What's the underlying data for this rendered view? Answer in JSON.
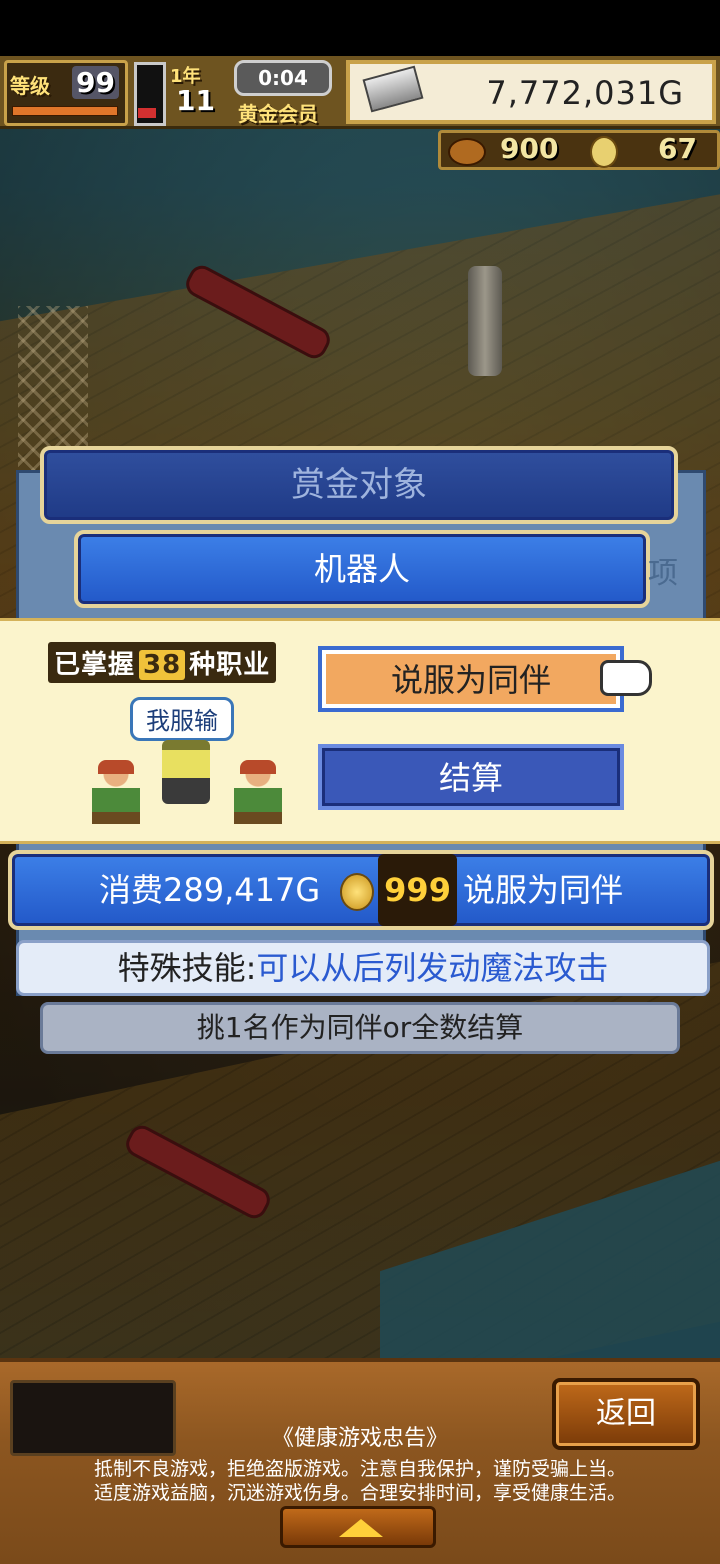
{
  "hud": {
    "level_label": "等级",
    "level": "99",
    "year_label": "1年",
    "year": "11",
    "clock": "0:04",
    "member": "黄金会员",
    "gold": "7,772,031G",
    "food": "900",
    "medals": "67"
  },
  "dialog": {
    "title": "赏金对象",
    "target": "机器人",
    "ghost": "项"
  },
  "recruit": {
    "jobs_prefix": "已掌握",
    "jobs_count": "38",
    "jobs_suffix": "种职业",
    "speech": "我服输",
    "recruit_button": "说服为同伴",
    "settle_button": "结算"
  },
  "cost": {
    "prefix": "消费289,417G",
    "coins": "999",
    "suffix": "说服为同伴"
  },
  "skill": {
    "label": "特殊技能:",
    "value": "可以从后列发动魔法攻击"
  },
  "hint": "挑1名作为同伴or全数结算",
  "footer": {
    "back_button": "返回",
    "advice_title": "《健康游戏忠告》",
    "advice_line1": "抵制不良游戏，拒绝盗版游戏。注意自我保护，谨防受骗上当。",
    "advice_line2": "适度游戏益脑，沉迷游戏伤身。合理安排时间，享受健康生活。"
  }
}
